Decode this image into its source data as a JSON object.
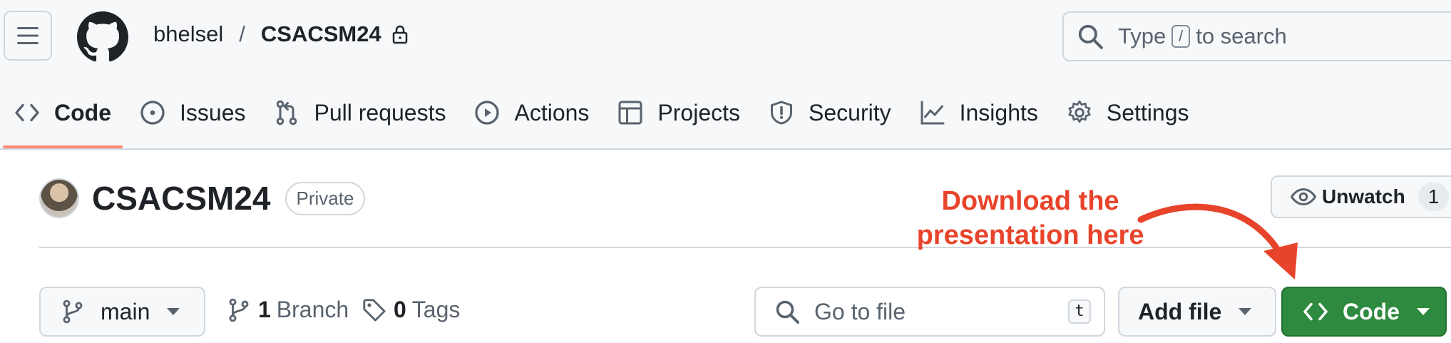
{
  "header": {
    "owner": "bhelsel",
    "separator": "/",
    "repo": "CSACSM24",
    "search_prefix": "Type",
    "search_key": "/",
    "search_suffix": "to search"
  },
  "tabs": [
    {
      "label": "Code",
      "icon": "code-icon"
    },
    {
      "label": "Issues",
      "icon": "issue-circle-icon"
    },
    {
      "label": "Pull requests",
      "icon": "pull-request-icon"
    },
    {
      "label": "Actions",
      "icon": "play-icon"
    },
    {
      "label": "Projects",
      "icon": "table-icon"
    },
    {
      "label": "Security",
      "icon": "shield-icon"
    },
    {
      "label": "Insights",
      "icon": "graph-icon"
    },
    {
      "label": "Settings",
      "icon": "gear-icon"
    }
  ],
  "repo_header": {
    "title": "CSACSM24",
    "visibility": "Private",
    "unwatch_label": "Unwatch",
    "watch_count": "1"
  },
  "annotation": {
    "line1": "Download the",
    "line2": "presentation here",
    "color": "#e8442b"
  },
  "toolbar": {
    "branch": "main",
    "branch_count": "1",
    "branch_label": "Branch",
    "tag_count": "0",
    "tag_label": "Tags",
    "goto_placeholder": "Go to file",
    "goto_key": "t",
    "add_file": "Add file",
    "code_button": "Code",
    "code_button_color": "#2d8a3e"
  }
}
